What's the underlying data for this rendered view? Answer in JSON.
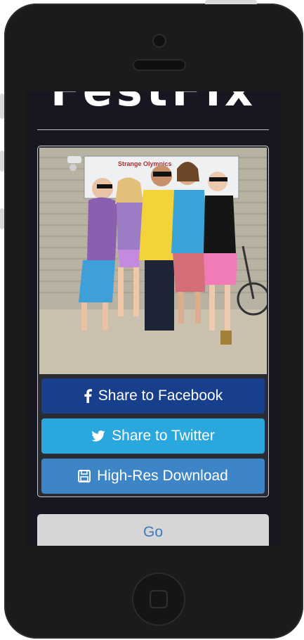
{
  "app": {
    "logo_text": "FestFix"
  },
  "share": {
    "facebook_label": "Share to Facebook",
    "twitter_label": "Share to Twitter",
    "download_label": "High-Res Download"
  },
  "photo": {
    "sign_text": "Strange Olympics"
  },
  "actions": {
    "go_label": "Go"
  },
  "icons": {
    "facebook": "facebook-icon",
    "twitter": "twitter-icon",
    "download": "floppy-disk-icon"
  },
  "colors": {
    "facebook": "#173f8c",
    "twitter": "#2aa7dc",
    "download": "#3d85c6",
    "screen_bg": "#171722"
  }
}
